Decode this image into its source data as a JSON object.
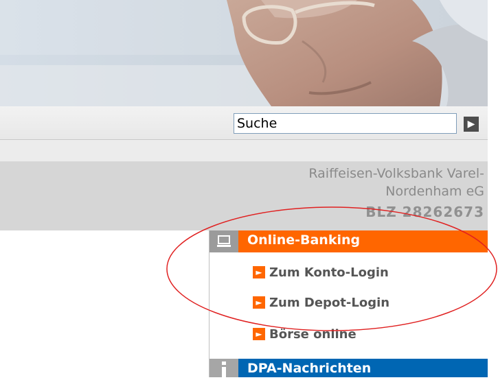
{
  "search": {
    "value": "Suche",
    "button_icon": "arrow-right-icon"
  },
  "bank": {
    "name_line1": "Raiffeisen-Volksbank Varel-",
    "name_line2": "Nordenham eG",
    "blz": "BLZ 28262673"
  },
  "nav": {
    "online_banking": {
      "title": "Online-Banking",
      "icon": "computer-icon",
      "items": [
        {
          "label": "Zum Konto-Login"
        },
        {
          "label": "Zum Depot-Login"
        },
        {
          "label": "Börse online"
        }
      ]
    },
    "news": {
      "title": "DPA-Nachrichten",
      "icon": "info-icon"
    }
  },
  "colors": {
    "accent_orange": "#ff6600",
    "accent_blue": "#0066b3",
    "annotation_red": "#e02020"
  }
}
